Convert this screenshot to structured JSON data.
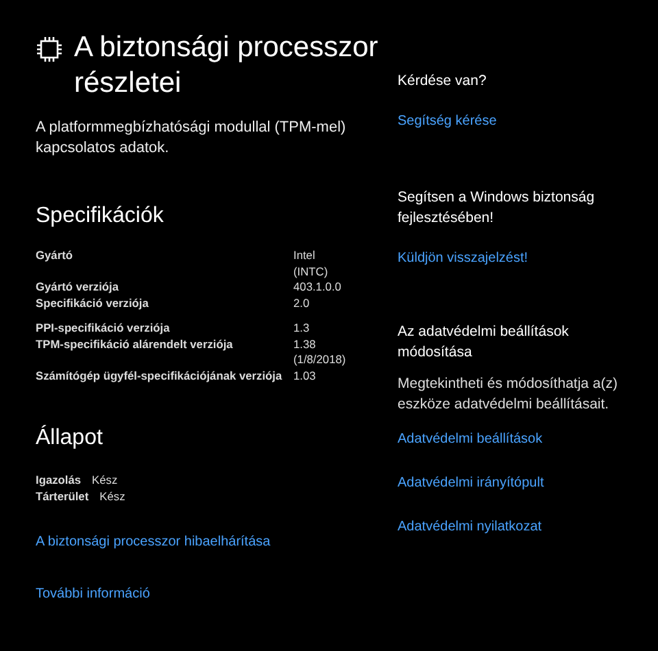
{
  "page": {
    "title": "A biztonsági processzor részletei",
    "description": "A platformmegbízhatósági modullal (TPM-mel) kapcsolatos adatok."
  },
  "specifications": {
    "heading": "Specifikációk",
    "groups": [
      [
        {
          "label": "Gyártó",
          "value": [
            "Intel",
            "(INTC)"
          ]
        },
        {
          "label": "Gyártó verziója",
          "value": [
            "403.1.0.0"
          ]
        },
        {
          "label": "Specifikáció verziója",
          "value": [
            "2.0"
          ]
        }
      ],
      [
        {
          "label": "PPI-specifikáció verziója",
          "value": [
            "1.3"
          ]
        },
        {
          "label": "TPM-specifikáció alárendelt verziója",
          "value": [
            "1.38",
            "(1/8/2018)"
          ]
        },
        {
          "label": "Számítógép ügyfél-specifikációjának verziója",
          "value": [
            "1.03"
          ]
        }
      ]
    ]
  },
  "status": {
    "heading": "Állapot",
    "rows": [
      {
        "label": "Igazolás",
        "value": "Kész"
      },
      {
        "label": "Tárterület",
        "value": "Kész"
      }
    ]
  },
  "links": [
    "A biztonsági processzor hibaelhárítása",
    "További információ"
  ],
  "sidebar": [
    {
      "heading": "Kérdése van?",
      "links": [
        "Segítség kérése"
      ]
    },
    {
      "heading": "Segítsen a Windows biztonság fejlesztésében!",
      "links": [
        "Küldjön visszajelzést!"
      ]
    },
    {
      "heading": "Az adatvédelmi beállítások módosítása",
      "text": "Megtekintheti és módosíthatja a(z) eszköze adatvédelmi beállításait.",
      "links": [
        "Adatvédelmi beállítások",
        "Adatvédelmi irányítópult",
        "Adatvédelmi nyilatkozat"
      ]
    }
  ]
}
